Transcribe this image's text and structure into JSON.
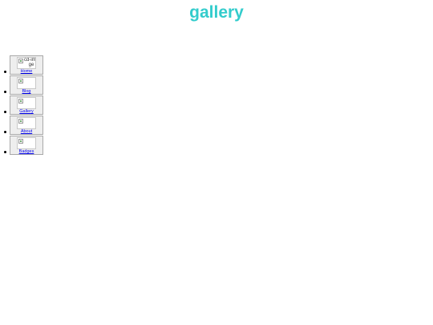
{
  "header": {
    "title": "gallery"
  },
  "colors": {
    "title": "#33cccc",
    "link": "#0000ee"
  },
  "nav": {
    "items": [
      {
        "label": "Home",
        "image_alt": "cd-image"
      },
      {
        "label": "Blog",
        "image_alt": ""
      },
      {
        "label": "Gallery",
        "image_alt": ""
      },
      {
        "label": "About",
        "image_alt": ""
      },
      {
        "label": "Badges",
        "image_alt": ""
      }
    ]
  }
}
